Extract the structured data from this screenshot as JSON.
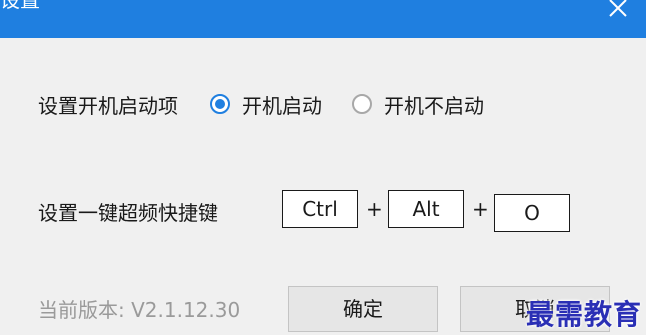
{
  "window": {
    "title": "设置",
    "titlebar_color": "#1f7fe0",
    "close_icon": "close-icon"
  },
  "startup": {
    "label": "设置开机启动项",
    "options": [
      {
        "label": "开机启动",
        "checked": true
      },
      {
        "label": "开机不启动",
        "checked": false
      }
    ]
  },
  "hotkey": {
    "label": "设置一键超频快捷键",
    "keys": [
      "Ctrl",
      "Alt",
      "O"
    ],
    "separator": "+"
  },
  "footer": {
    "version": "当前版本: V2.1.12.30",
    "confirm_label": "确定",
    "cancel_label": "取消"
  },
  "watermark": "最需教育"
}
